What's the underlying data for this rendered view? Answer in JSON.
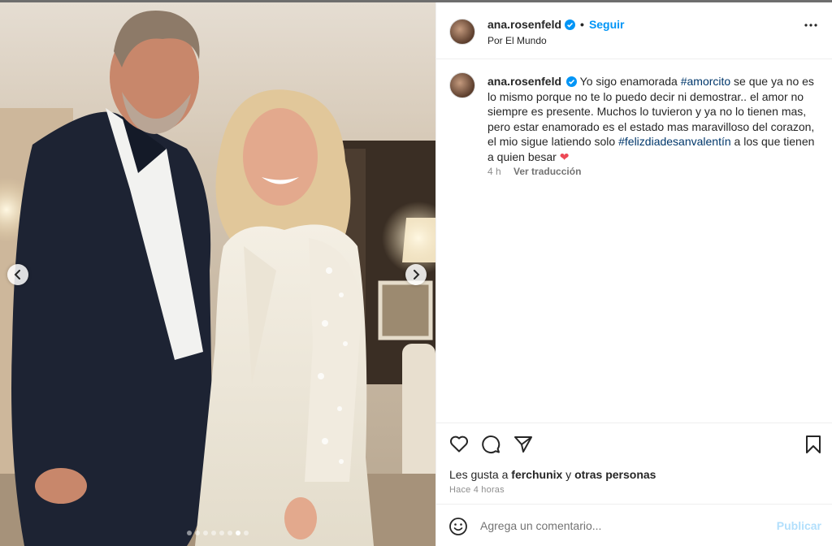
{
  "post": {
    "author": "ana.rosenfeld",
    "follow_label": "Seguir",
    "separator": "•",
    "location": "Por El Mundo",
    "caption": {
      "part1": "Yo sigo enamorada ",
      "hashtag1": "#amorcito",
      "part2": " se que ya no es lo mismo porque no te lo puedo decir ni demostrar.. el amor no siempre es presente. Muchos lo tuvieron y ya no lo tienen mas, pero estar enamorado es el estado mas maravilloso del corazon, el mio sigue latiendo solo ",
      "hashtag2": "#felizdiadesanvalentín",
      "part3": " a los que tienen a quien besar ",
      "heart": "❤"
    },
    "caption_time": "4 h",
    "translate_label": "Ver traducción",
    "likes_prefix": "Les gusta a ",
    "likes_user": "ferchunix",
    "likes_mid": " y ",
    "likes_rest": "otras personas",
    "posted_time": "Hace 4 horas",
    "comment_placeholder": "Agrega un comentario...",
    "publish_label": "Publicar"
  },
  "carousel": {
    "total_images": 8,
    "active_index": 6
  },
  "icons": {
    "like": "heart-outline-icon",
    "comment": "speech-bubble-icon",
    "share": "paper-plane-icon",
    "save": "bookmark-icon",
    "more": "ellipsis-icon",
    "emoji": "smiley-icon",
    "verified": "verified-badge-icon",
    "prev": "chevron-left-icon",
    "next": "chevron-right-icon"
  },
  "colors": {
    "accent": "#0095f6",
    "hashtag": "#00376b",
    "heart": "#ed4956",
    "publish_disabled": "#b2dffc"
  }
}
